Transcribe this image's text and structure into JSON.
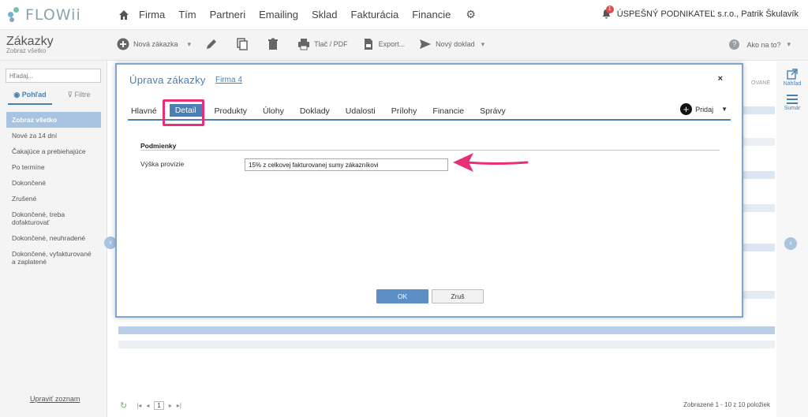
{
  "app": {
    "logo_text": "FLOWii"
  },
  "nav": {
    "items": [
      "Firma",
      "Tím",
      "Partneri",
      "Emailing",
      "Sklad",
      "Fakturácia",
      "Financie"
    ]
  },
  "user": {
    "notification_count": "1",
    "label": "ÚSPEŠNÝ PODNIKATEĽ s.r.o., Patrik Škulavík"
  },
  "page": {
    "title": "Zákazky",
    "subtitle": "Zobraz všetko"
  },
  "toolbar": {
    "new_order": "Nová zákazka",
    "print_pdf": "Tlač / PDF",
    "export": "Export...",
    "new_document": "Nový doklad",
    "help": "Ako na to?"
  },
  "sidebar": {
    "filter_placeholder": "Hľadaj...",
    "tab_view": "Pohľad",
    "tab_filters": "Filtre",
    "items": [
      "Zobraz všetko",
      "Nové za 14 dní",
      "Čakajúce a prebiehajúce",
      "Po termíne",
      "Dokončené",
      "Zrušené",
      "Dokončené, treba dofakturovať",
      "Dokončené, neuhradené",
      "Dokončené, vyfakturované a zaplatené"
    ],
    "footer": "Upraviť zoznam"
  },
  "right_panel": {
    "preview": "Náhľad",
    "summary": "Sumár"
  },
  "grid": {
    "col_header_fragment": "OVANÉ"
  },
  "pager": {
    "page": "1",
    "count_text": "Zobrazené 1 - 10 z 10 položiek"
  },
  "modal": {
    "title": "Úprava zákazky",
    "firm_link": "Firma 4",
    "close": "×",
    "tabs": [
      "Hlavné",
      "Detail",
      "Produkty",
      "Úlohy",
      "Doklady",
      "Udalosti",
      "Prílohy",
      "Financie",
      "Správy"
    ],
    "active_tab": "Detail",
    "add_label": "Pridaj",
    "section_title": "Podmienky",
    "field_label": "Výška provízie",
    "field_value": "15% z celkovej fakturovanej sumy zákazníkovi",
    "ok": "OK",
    "cancel": "Zruš"
  },
  "colors": {
    "accent": "#4a7fb5",
    "highlight": "#e8307a",
    "sidebar_active": "#a8c4e1"
  }
}
